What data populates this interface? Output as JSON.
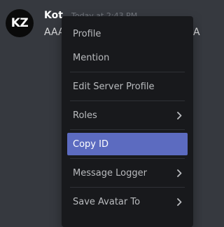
{
  "message": {
    "avatar_text": "KZ",
    "username": "Kot",
    "timestamp": "Today at 2:43 PM",
    "content": "AAA",
    "content_right": "A"
  },
  "context_menu": {
    "items": [
      {
        "label": "Profile",
        "has_submenu": false
      },
      {
        "label": "Mention",
        "has_submenu": false
      },
      {
        "label": "Edit Server Profile",
        "has_submenu": false
      },
      {
        "label": "Roles",
        "has_submenu": true
      },
      {
        "label": "Copy ID",
        "has_submenu": false,
        "highlighted": true
      },
      {
        "label": "Message Logger",
        "has_submenu": true
      },
      {
        "label": "Save Avatar To",
        "has_submenu": true
      }
    ]
  },
  "colors": {
    "background": "#36393f",
    "menu_background": "#18191c",
    "highlight": "#5c6bc0",
    "menu_text": "#b9bbbe",
    "timestamp": "#72767d"
  }
}
